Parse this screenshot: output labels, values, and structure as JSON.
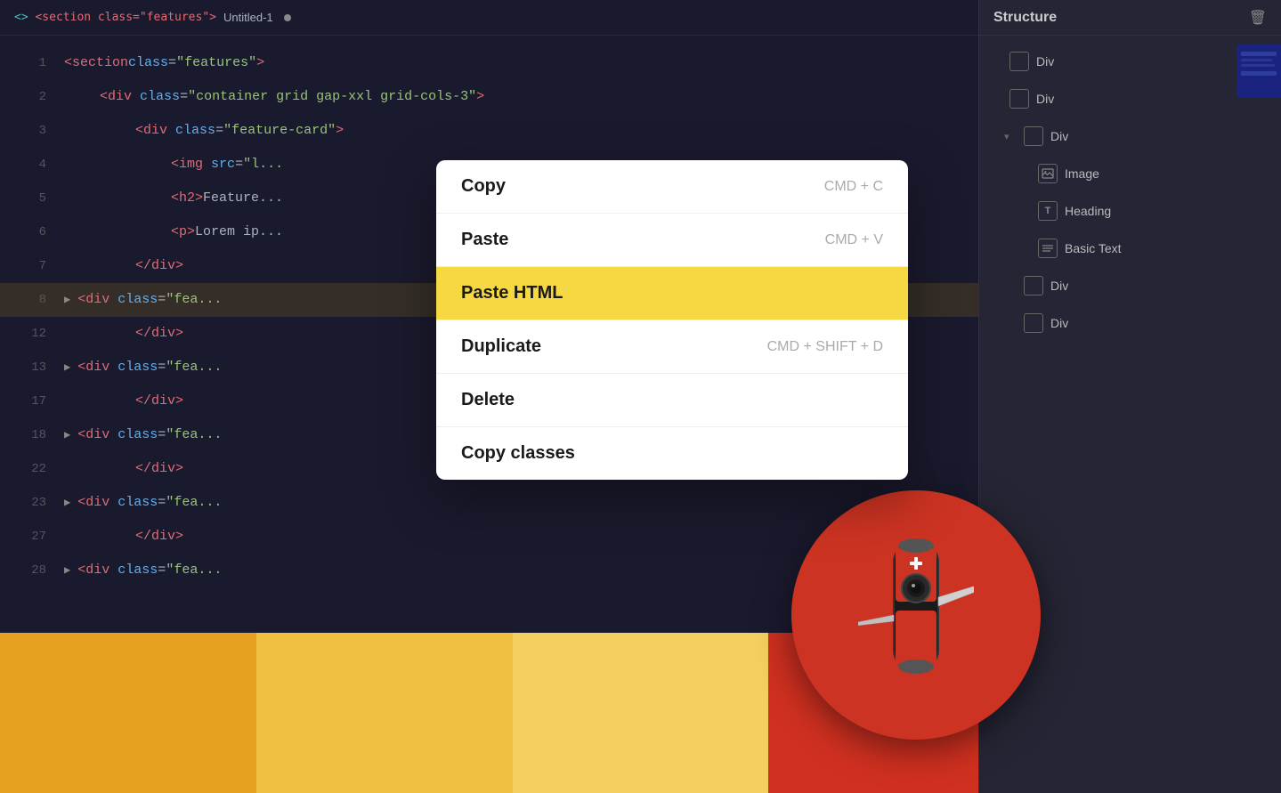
{
  "titleBar": {
    "tag": "<section class=\"features\">",
    "filename": "Untitled-1",
    "dot": "●"
  },
  "codeLines": [
    {
      "num": "1",
      "indent": 0,
      "content": "<section class=\"features\">"
    },
    {
      "num": "2",
      "indent": 1,
      "content": "<div class=\"container grid gap-xxl grid-cols-3\">"
    },
    {
      "num": "3",
      "indent": 2,
      "content": "<div class=\"feature-card\">"
    },
    {
      "num": "4",
      "indent": 3,
      "content": "<img src=\"[...\""
    },
    {
      "num": "5",
      "indent": 3,
      "content": "<h2>Feature..."
    },
    {
      "num": "6",
      "indent": 3,
      "content": "<p>Lorem ip..."
    },
    {
      "num": "7",
      "indent": 2,
      "content": "</div>"
    },
    {
      "num": "8",
      "indent": 1,
      "content": "<div class=\"fea..."
    },
    {
      "num": "12",
      "indent": 2,
      "content": "</div>"
    },
    {
      "num": "13",
      "indent": 1,
      "content": "<div class=\"fea..."
    },
    {
      "num": "17",
      "indent": 2,
      "content": "</div>"
    },
    {
      "num": "18",
      "indent": 1,
      "content": "<div class=\"fea..."
    },
    {
      "num": "22",
      "indent": 2,
      "content": "</div>"
    },
    {
      "num": "23",
      "indent": 1,
      "content": "<div class=\"fea..."
    },
    {
      "num": "27",
      "indent": 2,
      "content": "</div>"
    },
    {
      "num": "28",
      "indent": 1,
      "content": "<div class=\"fea..."
    }
  ],
  "rightPanel": {
    "title": "Structure",
    "deleteIcon": "🗑",
    "items": [
      {
        "label": "Div",
        "indent": 0,
        "hasChevron": false
      },
      {
        "label": "Div",
        "indent": 0,
        "hasChevron": false
      },
      {
        "label": "Div",
        "indent": 1,
        "hasChevron": true,
        "expanded": true
      },
      {
        "label": "Image",
        "indent": 2,
        "type": "image"
      },
      {
        "label": "Heading",
        "indent": 2,
        "type": "text"
      },
      {
        "label": "Basic Text",
        "indent": 2,
        "type": "lines"
      },
      {
        "label": "Div",
        "indent": 1,
        "hasChevron": false
      },
      {
        "label": "Div",
        "indent": 1,
        "hasChevron": false
      }
    ]
  },
  "contextMenu": {
    "items": [
      {
        "label": "Copy",
        "shortcut": "CMD + C",
        "highlighted": false
      },
      {
        "label": "Paste",
        "shortcut": "CMD + V",
        "highlighted": false
      },
      {
        "label": "Paste HTML",
        "shortcut": "",
        "highlighted": true
      },
      {
        "label": "Duplicate",
        "shortcut": "CMD + SHIFT + D",
        "highlighted": false
      },
      {
        "label": "Delete",
        "shortcut": "",
        "highlighted": false
      },
      {
        "label": "Copy classes",
        "shortcut": "",
        "highlighted": false
      }
    ]
  },
  "colors": {
    "accent": "#f5d842",
    "logoRed": "#cc3322",
    "barOrange": "#e8a020",
    "barYellow": "#f0c040",
    "barRed": "#d03020"
  }
}
